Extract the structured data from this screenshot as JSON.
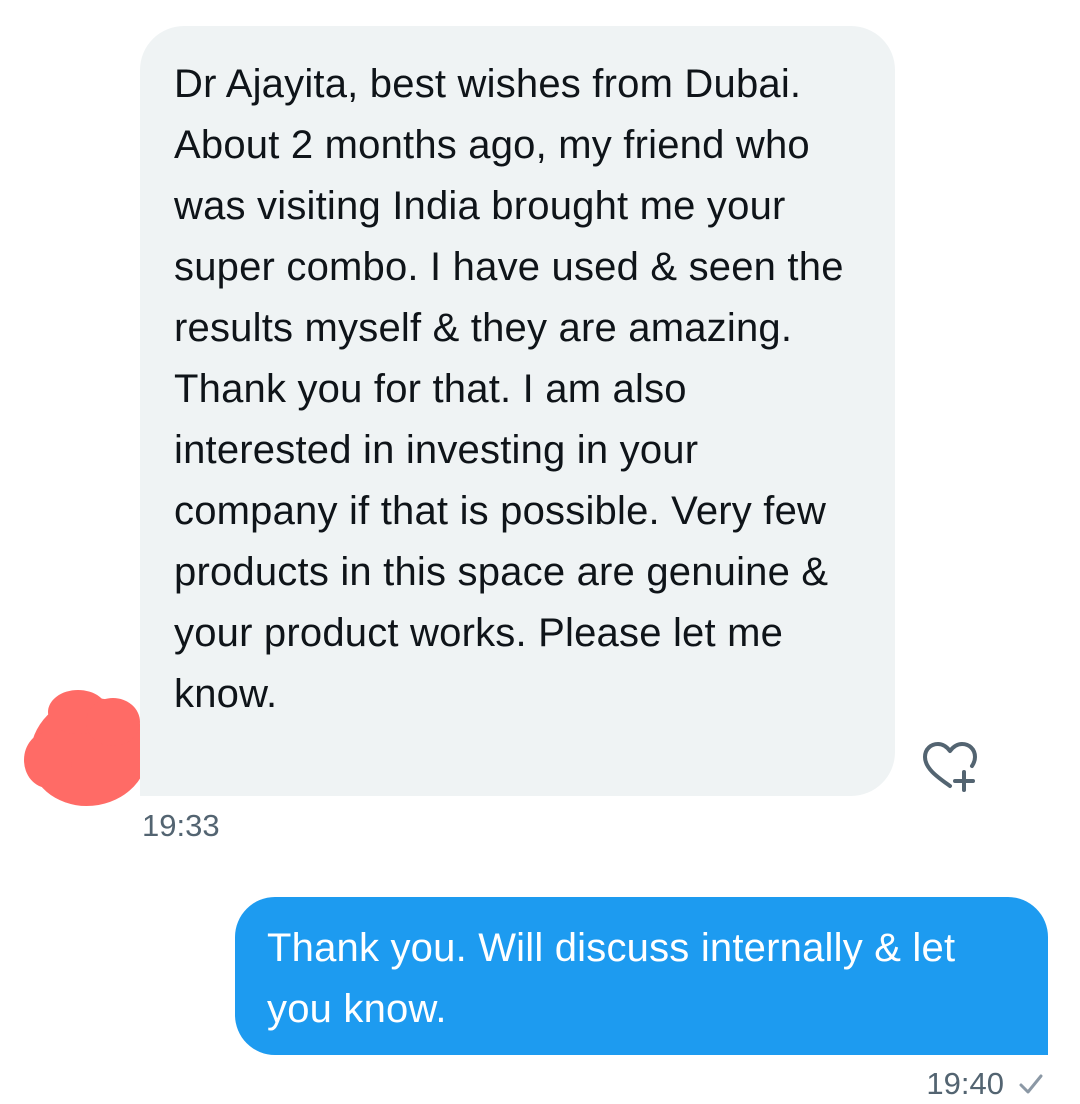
{
  "messages": {
    "incoming": {
      "text": "Dr Ajayita, best wishes from Dubai. About 2 months ago, my friend who was visiting India brought me your super combo. I have used & seen the results myself & they are amazing. Thank you for that. I am also interested in investing in your company if that is possible. Very few products in this space are genuine & your product works. Please let me know.",
      "time": "19:33",
      "reaction_icon": "heart-plus-icon"
    },
    "outgoing": {
      "text": "Thank you. Will discuss internally & let you know.",
      "time": "19:40",
      "status_icon": "check-icon"
    }
  },
  "colors": {
    "incoming_bubble": "#eff3f4",
    "outgoing_bubble": "#1d9bf0",
    "avatar_redaction": "#ff6b66",
    "timestamp": "#536471"
  }
}
